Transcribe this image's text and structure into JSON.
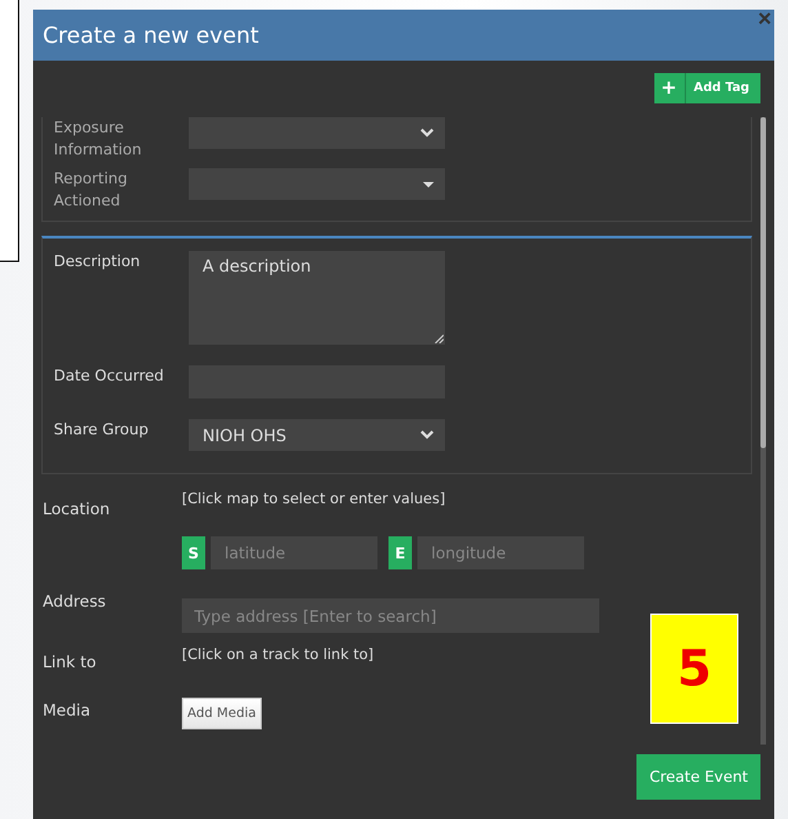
{
  "dialog": {
    "title": "Create a new event",
    "close": "×"
  },
  "add_tag": {
    "icon": "+",
    "label": "Add Tag"
  },
  "section_1": [
    {
      "label": "Exposure Information",
      "kind": "select"
    },
    {
      "label": "Reporting Actioned",
      "kind": "combo"
    }
  ],
  "section_2": [
    {
      "label": "Description",
      "kind": "textarea",
      "value": "A description"
    },
    {
      "label": "Date Occurred",
      "kind": "input"
    },
    {
      "label": "Share Group",
      "kind": "select",
      "value": "NIOH OHS"
    }
  ],
  "location": {
    "label": "Location",
    "hint": "[Click map to select or enter values]",
    "lat_prefix": "S",
    "lat_placeholder": "latitude",
    "lon_prefix": "E",
    "lon_placeholder": "longitude"
  },
  "address": {
    "label": "Address",
    "placeholder": "Type address [Enter to search]"
  },
  "link_to": {
    "label": "Link to",
    "hint": "[Click on a track to link to]"
  },
  "media": {
    "label": "Media",
    "button": "Add Media"
  },
  "annotation": "5",
  "submit": "Create Event"
}
